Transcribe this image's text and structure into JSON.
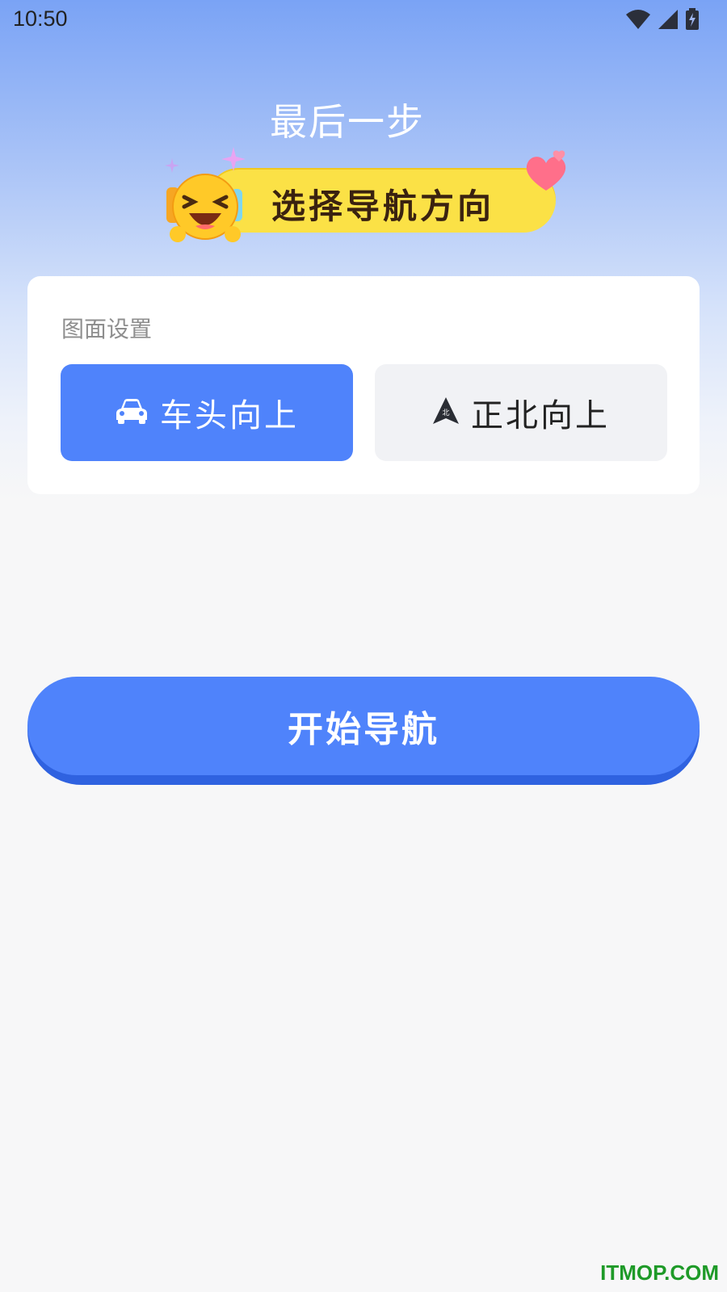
{
  "status_bar": {
    "time": "10:50",
    "icons": [
      "wifi-icon",
      "signal-icon",
      "battery-charging-icon"
    ]
  },
  "header": {
    "title": "最后一步",
    "banner_text": "选择导航方向",
    "banner_icons": [
      "laughing-emoji-icon",
      "heart-icon",
      "sparkle-icon"
    ]
  },
  "settings": {
    "label": "图面设置",
    "options": [
      {
        "label": "车头向上",
        "icon": "car-icon",
        "selected": true
      },
      {
        "label": "正北向上",
        "icon": "north-arrow-icon",
        "selected": false
      }
    ]
  },
  "actions": {
    "start_label": "开始导航"
  },
  "watermark": "ITMOP.COM",
  "colors": {
    "accent": "#4f83fb",
    "accent_shadow": "#2f62e0",
    "banner_yellow": "#fbe146",
    "option_inactive": "#f1f2f5",
    "watermark": "#1e9a28"
  }
}
